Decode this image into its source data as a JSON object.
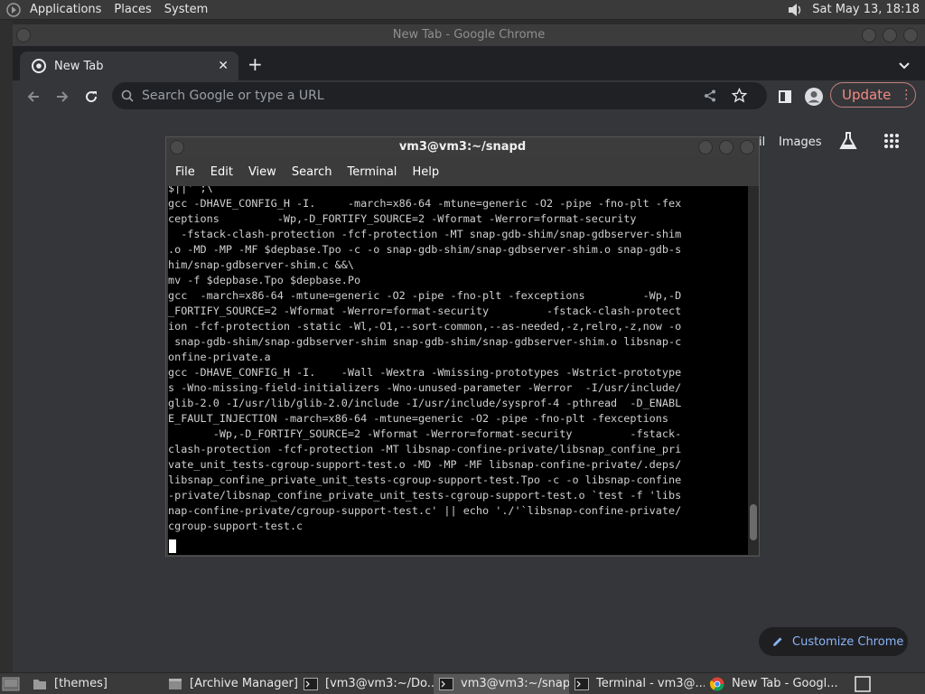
{
  "top_panel": {
    "menus": [
      "Applications",
      "Places",
      "System"
    ],
    "clock": "Sat May 13, 18:18"
  },
  "chrome": {
    "window_title": "New Tab - Google Chrome",
    "tab_title": "New Tab",
    "omnibox_placeholder": "Search Google or type a URL",
    "update_label": "Update",
    "images_link": "Images",
    "gmail_fragment": "il",
    "customize_label": "Customize Chrome"
  },
  "terminal": {
    "title": "vm3@vm3:~/snapd",
    "menus": [
      "File",
      "Edit",
      "View",
      "Search",
      "Terminal",
      "Help"
    ],
    "lines": [
      "$||'`;\\",
      "gcc -DHAVE_CONFIG_H -I.     -march=x86-64 -mtune=generic -O2 -pipe -fno-plt -fex",
      "ceptions         -Wp,-D_FORTIFY_SOURCE=2 -Wformat -Werror=format-security",
      "  -fstack-clash-protection -fcf-protection -MT snap-gdb-shim/snap-gdbserver-shim",
      ".o -MD -MP -MF $depbase.Tpo -c -o snap-gdb-shim/snap-gdbserver-shim.o snap-gdb-s",
      "him/snap-gdbserver-shim.c &&\\",
      "mv -f $depbase.Tpo $depbase.Po",
      "gcc  -march=x86-64 -mtune=generic -O2 -pipe -fno-plt -fexceptions         -Wp,-D",
      "_FORTIFY_SOURCE=2 -Wformat -Werror=format-security         -fstack-clash-protect",
      "ion -fcf-protection -static -Wl,-O1,--sort-common,--as-needed,-z,relro,-z,now -o",
      " snap-gdb-shim/snap-gdbserver-shim snap-gdb-shim/snap-gdbserver-shim.o libsnap-c",
      "onfine-private.a",
      "gcc -DHAVE_CONFIG_H -I.    -Wall -Wextra -Wmissing-prototypes -Wstrict-prototype",
      "s -Wno-missing-field-initializers -Wno-unused-parameter -Werror  -I/usr/include/",
      "glib-2.0 -I/usr/lib/glib-2.0/include -I/usr/include/sysprof-4 -pthread  -D_ENABL",
      "E_FAULT_INJECTION -march=x86-64 -mtune=generic -O2 -pipe -fno-plt -fexceptions",
      "       -Wp,-D_FORTIFY_SOURCE=2 -Wformat -Werror=format-security         -fstack-",
      "clash-protection -fcf-protection -MT libsnap-confine-private/libsnap_confine_pri",
      "vate_unit_tests-cgroup-support-test.o -MD -MP -MF libsnap-confine-private/.deps/",
      "libsnap_confine_private_unit_tests-cgroup-support-test.Tpo -c -o libsnap-confine",
      "-private/libsnap_confine_private_unit_tests-cgroup-support-test.o `test -f 'libs",
      "nap-confine-private/cgroup-support-test.c' || echo './'`libsnap-confine-private/",
      "cgroup-support-test.c"
    ]
  },
  "taskbar": {
    "items": [
      {
        "label": "[themes]",
        "icon": "folder-icon",
        "active": false
      },
      {
        "label": "[Archive Manager]",
        "icon": "archive-icon",
        "active": false
      },
      {
        "label": "[vm3@vm3:~/Do...",
        "icon": "terminal-icon",
        "active": false
      },
      {
        "label": "vm3@vm3:~/snapd",
        "icon": "terminal-icon",
        "active": true
      },
      {
        "label": "Terminal - vm3@...",
        "icon": "terminal-icon",
        "active": false
      },
      {
        "label": "New Tab - Googl...",
        "icon": "chrome-icon",
        "active": false
      }
    ]
  },
  "colors": {
    "update_accent": "#f28b82",
    "link_blue": "#8ab4f8",
    "terminal_bg": "#000000"
  }
}
